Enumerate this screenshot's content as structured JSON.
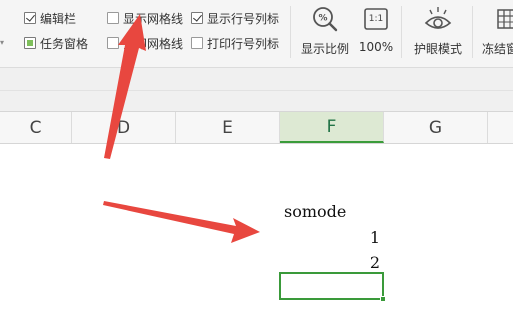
{
  "ribbon": {
    "checkboxes": [
      {
        "label": "编辑栏",
        "state": "checked"
      },
      {
        "label": "任务窗格",
        "state": "partial"
      },
      {
        "label": "显示网格线",
        "state": "unchecked"
      },
      {
        "label": "打印网格线",
        "state": "unchecked"
      },
      {
        "label": "显示行号列标",
        "state": "checked"
      },
      {
        "label": "打印行号列标",
        "state": "unchecked"
      }
    ],
    "buttons": [
      {
        "label": "显示比例",
        "icon": "zoom-percent-icon"
      },
      {
        "label": "100%",
        "icon": "one-to-one-icon",
        "icon_text": "1:1"
      },
      {
        "label": "护眼模式",
        "icon": "eye-icon"
      },
      {
        "label": "冻结窗",
        "icon": "freeze-panes-icon"
      }
    ]
  },
  "columns": [
    "C",
    "D",
    "E",
    "F",
    "G"
  ],
  "active_column": "F",
  "cells": [
    {
      "ref": "F1",
      "value": "somode"
    },
    {
      "ref": "F2",
      "value": "1"
    },
    {
      "ref": "F3",
      "value": "2"
    }
  ],
  "colors": {
    "arrow": "#e8473f",
    "selection": "#3a9a3a",
    "active_header_bg": "#dde9d3"
  }
}
